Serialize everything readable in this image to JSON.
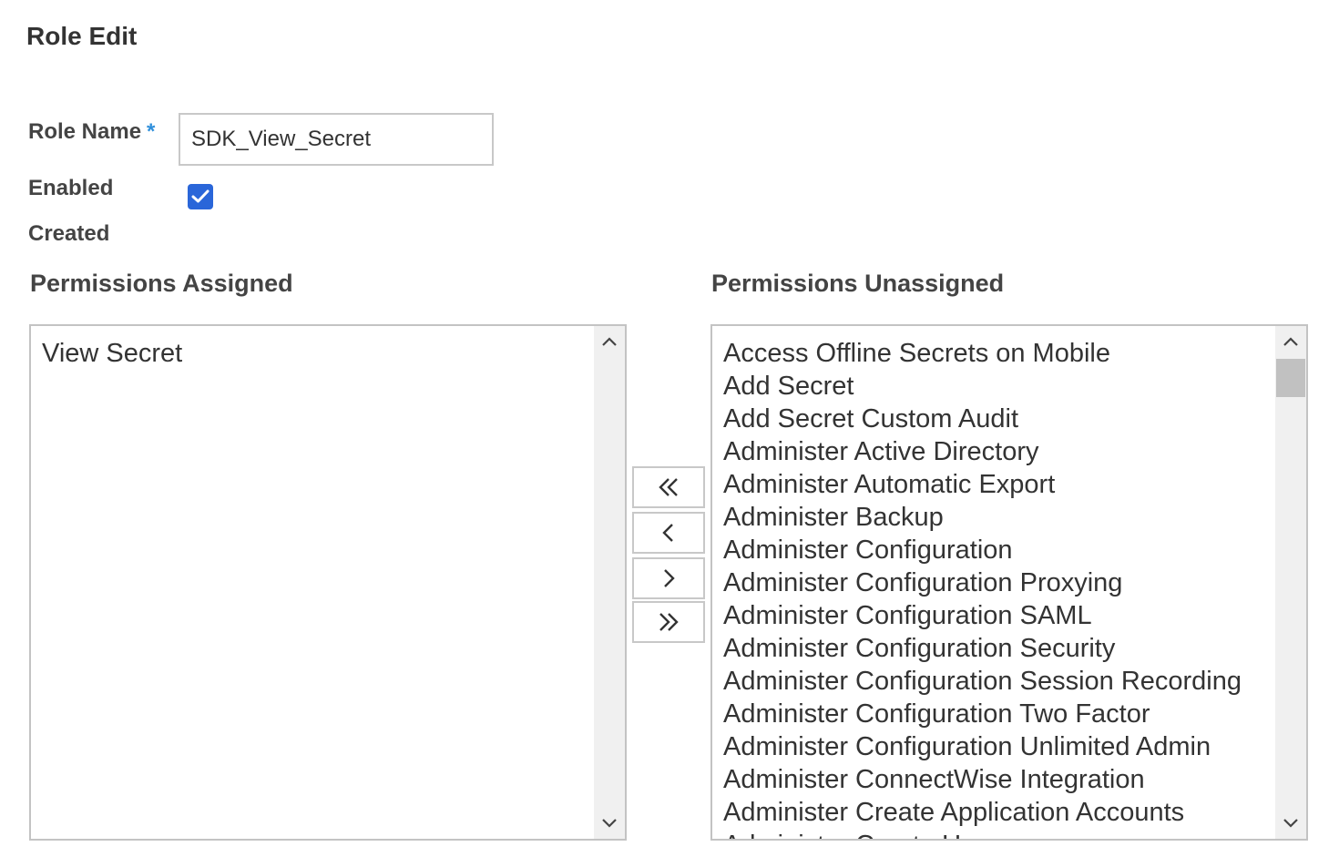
{
  "header": {
    "title": "Role Edit"
  },
  "form": {
    "role_name_label": "Role Name",
    "required_mark": "*",
    "role_name_value": "SDK_View_Secret",
    "enabled_label": "Enabled",
    "enabled_checked": true,
    "created_label": "Created"
  },
  "assigned": {
    "label": "Permissions Assigned",
    "items": [
      "View Secret"
    ]
  },
  "unassigned": {
    "label": "Permissions Unassigned",
    "items": [
      "Access Offline Secrets on Mobile",
      "Add Secret",
      "Add Secret Custom Audit",
      "Administer Active Directory",
      "Administer Automatic Export",
      "Administer Backup",
      "Administer Configuration",
      "Administer Configuration Proxying",
      "Administer Configuration SAML",
      "Administer Configuration Security",
      "Administer Configuration Session Recording",
      "Administer Configuration Two Factor",
      "Administer Configuration Unlimited Admin",
      "Administer ConnectWise Integration",
      "Administer Create Application Accounts",
      "Administer Create Users"
    ]
  },
  "buttons": {
    "move_all_left": "double-chevron-left-icon",
    "move_left": "chevron-left-icon",
    "move_right": "chevron-right-icon",
    "move_all_right": "double-chevron-right-icon"
  },
  "colors": {
    "accent": "#2a66d9",
    "required": "#2f8fdb",
    "border": "#c3c3c3",
    "scroll_thumb": "#c1c1c1"
  }
}
